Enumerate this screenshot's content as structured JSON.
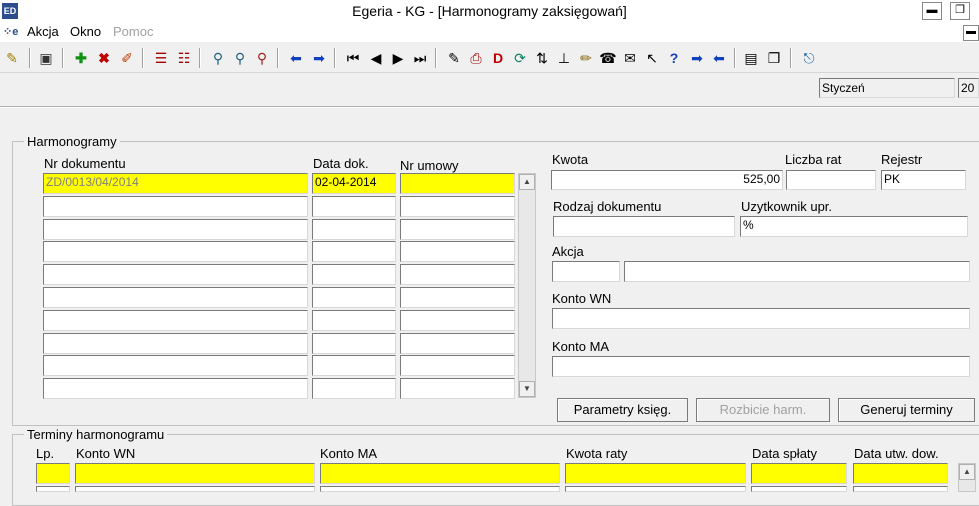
{
  "window": {
    "title": "Egeria - KG - [Harmonogramy zaksięgowań]",
    "icon": "egeria-app-icon",
    "minimize": "▬",
    "restore": "❐"
  },
  "menu": {
    "items": [
      "Akcja",
      "Okno",
      "Pomoc"
    ]
  },
  "period": {
    "month": "Styczeń",
    "year": "20"
  },
  "harmonogramy": {
    "section_label": "Harmonogramy",
    "col_nr_dok": "Nr dokumentu",
    "col_data_dok": "Data dok.",
    "col_nr_umowy": "Nr umowy",
    "rows": [
      {
        "nr_dok": "ZD/0013/04/2014",
        "data_dok": "02-04-2014",
        "nr_umowy": ""
      },
      {
        "nr_dok": "",
        "data_dok": "",
        "nr_umowy": ""
      },
      {
        "nr_dok": "",
        "data_dok": "",
        "nr_umowy": ""
      },
      {
        "nr_dok": "",
        "data_dok": "",
        "nr_umowy": ""
      },
      {
        "nr_dok": "",
        "data_dok": "",
        "nr_umowy": ""
      },
      {
        "nr_dok": "",
        "data_dok": "",
        "nr_umowy": ""
      },
      {
        "nr_dok": "",
        "data_dok": "",
        "nr_umowy": ""
      },
      {
        "nr_dok": "",
        "data_dok": "",
        "nr_umowy": ""
      },
      {
        "nr_dok": "",
        "data_dok": "",
        "nr_umowy": ""
      },
      {
        "nr_dok": "",
        "data_dok": "",
        "nr_umowy": ""
      }
    ]
  },
  "details": {
    "kwota_label": "Kwota",
    "kwota_value": "525,00",
    "liczba_rat_label": "Liczba rat",
    "liczba_rat_value": "",
    "rejestr_label": "Rejestr",
    "rejestr_value": "PK",
    "rodzaj_label": "Rodzaj dokumentu",
    "rodzaj_value": "",
    "uzytkownik_label": "Uzytkownik upr.",
    "uzytkownik_value": "%",
    "akcja_label": "Akcja",
    "akcja_code": "",
    "akcja_desc": "",
    "konto_wn_label": "Konto WN",
    "konto_wn_value": "",
    "konto_ma_label": "Konto MA",
    "konto_ma_value": ""
  },
  "buttons": {
    "parametry": "Parametry księg.",
    "rozbicie": "Rozbicie harm.",
    "generuj": "Generuj terminy"
  },
  "terminy": {
    "section_label": "Terminy harmonogramu",
    "col_lp": "Lp.",
    "col_konto_wn": "Konto WN",
    "col_konto_ma": "Konto MA",
    "col_kwota_raty": "Kwota raty",
    "col_data_splaty": "Data spłaty",
    "col_data_utw": "Data utw. dow."
  },
  "colors": {
    "highlight": "#ffff00",
    "background": "#f0f0f0"
  }
}
